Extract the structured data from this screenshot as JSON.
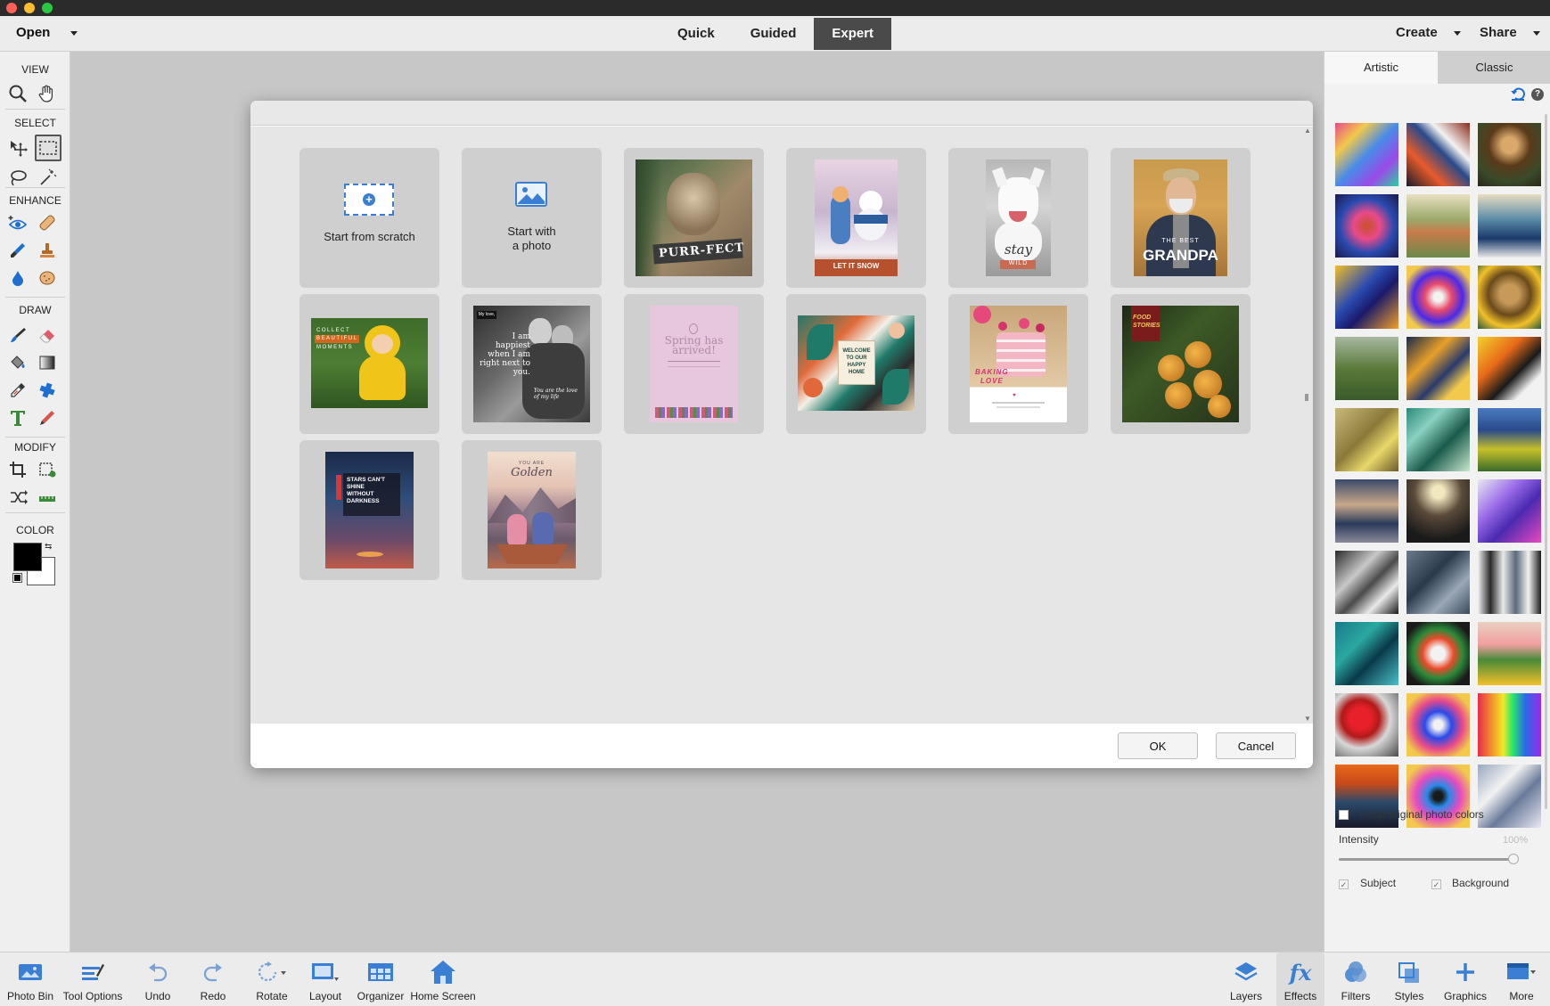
{
  "menubar": {
    "open_label": "Open",
    "modes": [
      "Quick",
      "Guided",
      "Expert"
    ],
    "active_mode": "Expert",
    "create_label": "Create",
    "share_label": "Share"
  },
  "toolbox": {
    "sections": {
      "view": "VIEW",
      "select": "SELECT",
      "enhance": "ENHANCE",
      "draw": "DRAW",
      "modify": "MODIFY",
      "color": "COLOR"
    },
    "foreground_color": "#000000",
    "background_color": "#ffffff"
  },
  "dialog": {
    "cards": [
      {
        "kind": "action",
        "label": "Start from scratch"
      },
      {
        "kind": "action",
        "label_line1": "Start with",
        "label_line2": "a photo"
      },
      {
        "kind": "template",
        "text": "PURR-FECT"
      },
      {
        "kind": "template",
        "text": "LET IT SNOW"
      },
      {
        "kind": "template",
        "text": "stay",
        "text2": "WILD"
      },
      {
        "kind": "template",
        "text": "THE BEST",
        "text2": "GRANDPA"
      },
      {
        "kind": "template",
        "text": "COLLECT",
        "text2": "BEAUTIFUL",
        "text3": "MOMENTS"
      },
      {
        "kind": "template",
        "text": "I am happiest when I am right next to you.",
        "text2": "You are the love of my life",
        "text3": "My love,"
      },
      {
        "kind": "template",
        "text": "Spring has arrived!"
      },
      {
        "kind": "template",
        "text": "WELCOME TO OUR HAPPY HOME"
      },
      {
        "kind": "template",
        "text": "BAKING",
        "text2": "LOVE"
      },
      {
        "kind": "template",
        "text": "FOOD",
        "text2": "STORIES"
      },
      {
        "kind": "template",
        "text": "STARS CAN'T SHINE WITHOUT DARKNESS"
      },
      {
        "kind": "template",
        "text": "YOU ARE",
        "text2": "Golden"
      }
    ],
    "ok_label": "OK",
    "cancel_label": "Cancel"
  },
  "rpanel": {
    "tabs": [
      "Artistic",
      "Classic"
    ],
    "active_tab": "Artistic",
    "keep_colors_label": "Keep original photo colors",
    "keep_colors_checked": false,
    "intensity_label": "Intensity",
    "intensity_value": "100%",
    "intensity": 1.0,
    "subject_label": "Subject",
    "subject_checked": true,
    "background_label": "Background",
    "background_checked": true,
    "styles_count": 30
  },
  "bottombar": {
    "left": [
      "Photo Bin",
      "Tool Options",
      "Undo",
      "Redo",
      "Rotate",
      "Layout",
      "Organizer",
      "Home Screen"
    ],
    "right": [
      "Layers",
      "Effects",
      "Filters",
      "Styles",
      "Graphics",
      "More"
    ],
    "active": "Effects"
  }
}
